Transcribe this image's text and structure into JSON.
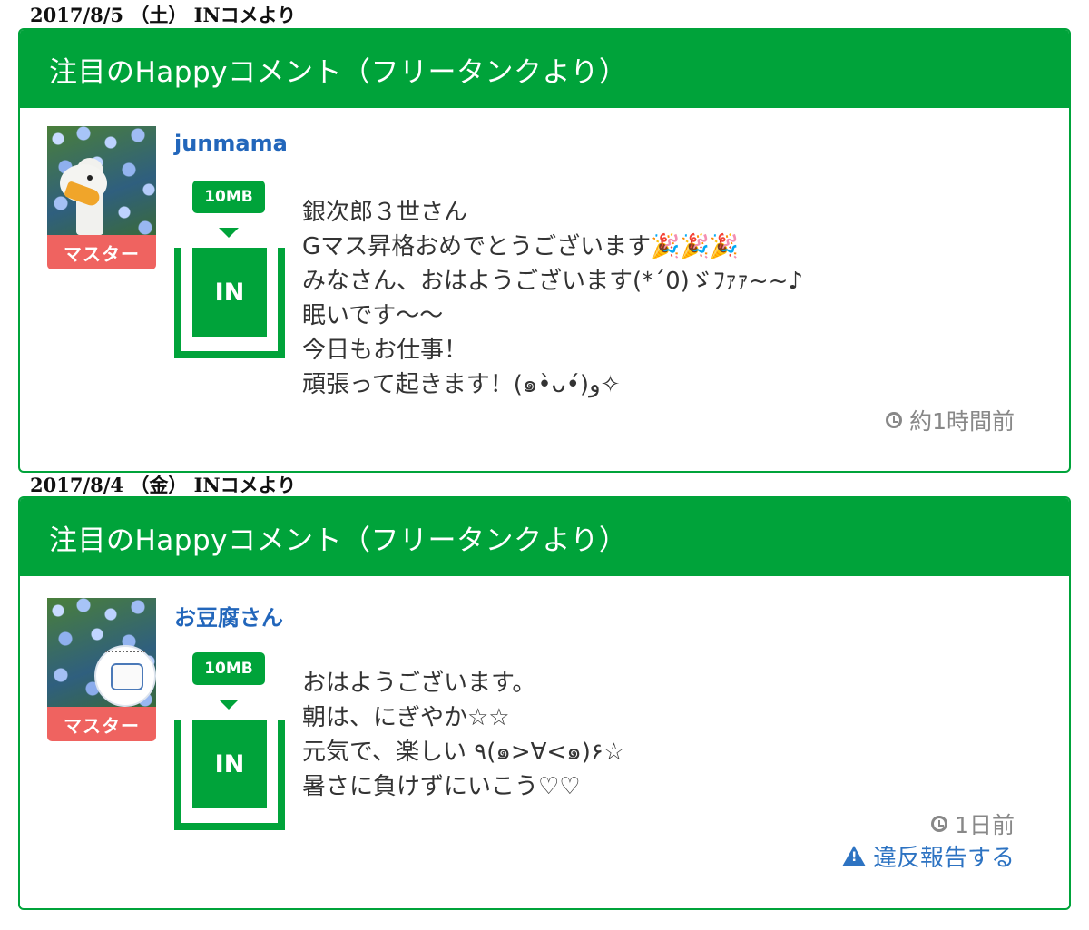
{
  "entries": [
    {
      "date_label": "2017/8/5 （土） INコメより",
      "header_title": "注目のHappyコメント（フリータンクより）",
      "avatar_icon": "goose-photo-icon",
      "role_badge": "マスター",
      "username": "junmama",
      "tank_size": "10MB",
      "tank_label": "IN",
      "comment_lines": [
        "銀次郎３世さん",
        "Gマス昇格おめでとうございます🎉🎉🎉",
        "みなさん、おはようございます(*´0)ゞﾌｧｧ~~♪",
        "眠いです〜〜",
        "今日もお仕事！",
        "頑張って起きます！(๑•̀ᴗ•́)و✧"
      ],
      "time_ago": "約1時間前"
    },
    {
      "date_label": "2017/8/4 （金） INコメより",
      "header_title": "注目のHappyコメント（フリータンクより）",
      "avatar_icon": "tofu-character-icon",
      "role_badge": "マスター",
      "username": "お豆腐さん",
      "tank_size": "10MB",
      "tank_label": "IN",
      "comment_lines": [
        "おはようございます。",
        "朝は、にぎやか☆☆",
        "元気で、楽しい ٩(๑>∀<๑)۶☆",
        "暑さに負けずにいこう♡♡"
      ],
      "time_ago": "1日前",
      "report_label": "違反報告する"
    }
  ],
  "colors": {
    "accent_green": "#00a33a",
    "badge_red": "#ef6360",
    "link_blue": "#2266bb"
  }
}
